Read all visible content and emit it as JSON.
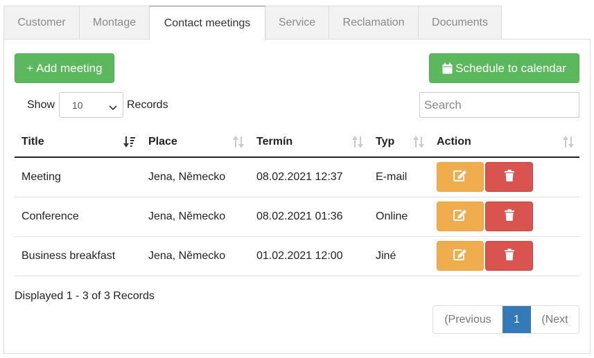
{
  "tabs": [
    {
      "label": "Customer"
    },
    {
      "label": "Montage"
    },
    {
      "label": "Contact meetings"
    },
    {
      "label": "Service"
    },
    {
      "label": "Reclamation"
    },
    {
      "label": "Documents"
    }
  ],
  "active_tab": "Contact meetings",
  "toolbar": {
    "add_label": "+ Add meeting",
    "schedule_label": "Schedule to calendar"
  },
  "length": {
    "show_label": "Show",
    "selected": "10",
    "records_label": "Records"
  },
  "search": {
    "placeholder": "Search",
    "value": ""
  },
  "table": {
    "headers": [
      "Title",
      "Place",
      "Termín",
      "Typ",
      "Action"
    ],
    "rows": [
      {
        "title": "Meeting",
        "place": "Jena, Německo",
        "termin": "08.02.2021 12:37",
        "typ": "E-mail"
      },
      {
        "title": "Conference",
        "place": "Jena, Německo",
        "termin": "08.02.2021 01:36",
        "typ": "Online"
      },
      {
        "title": "Business breakfast",
        "place": "Jena, Německo",
        "termin": "01.02.2021 12:00",
        "typ": "Jiné"
      }
    ]
  },
  "info": "Displayed 1 - 3 of 3 Records",
  "pagination": {
    "previous": "(Previous",
    "current": "1",
    "next": "(Next"
  },
  "icons": {
    "sort_active": "sort-amount-down-icon",
    "sort": "sort-icon",
    "edit": "edit-icon",
    "delete": "trash-icon",
    "calendar": "calendar-icon"
  },
  "colors": {
    "green": "#5cb85c",
    "warning": "#f0ad4e",
    "danger": "#d9534f",
    "primary": "#337ab7"
  }
}
